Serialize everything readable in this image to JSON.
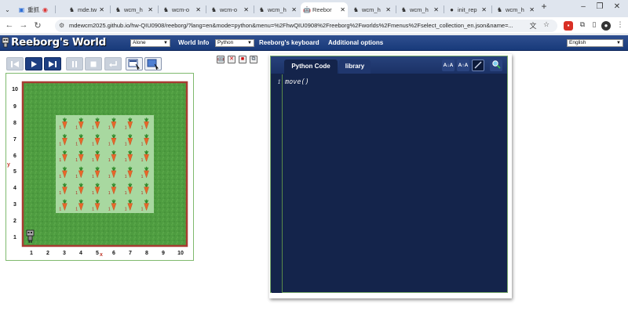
{
  "browser": {
    "tabs": [
      {
        "label": "",
        "icon": "group-icon",
        "group": "重抓"
      },
      {
        "label": "mde.tw",
        "icon": "hat-icon"
      },
      {
        "label": "wcm_h",
        "icon": "hat-icon"
      },
      {
        "label": "wcm-o",
        "icon": "hat-icon"
      },
      {
        "label": "wcm-o",
        "icon": "hat-icon"
      },
      {
        "label": "wcm_h",
        "icon": "hat-icon"
      },
      {
        "label": "Reebor",
        "icon": "robot-icon",
        "active": true
      },
      {
        "label": "wcm_h",
        "icon": "hat-icon"
      },
      {
        "label": "wcm_h",
        "icon": "hat-icon"
      },
      {
        "label": "init_rep",
        "icon": "github-icon"
      },
      {
        "label": "wcm_h",
        "icon": "hat-icon"
      }
    ],
    "url": "mdewcm2025.github.io/hw-QIU0908/reeborg/?lang=en&mode=python&menu=%2FhwQIU0908%2Freeborg%2Fworlds%2Fmenus%2Fselect_collection_en.json&name=...",
    "group_label": "重抓"
  },
  "reeborg": {
    "logo": "Reeborg's World",
    "world_select": "Alone",
    "world_info_label": "World Info",
    "mode_select": "Python",
    "keyboard_label": "Reeborg's keyboard",
    "options_label": "Additional options",
    "language_select": "English"
  },
  "world": {
    "columns": 10,
    "rows": 10,
    "x_ticks": [
      "1",
      "2",
      "3",
      "4",
      "5",
      "6",
      "7",
      "8",
      "9",
      "10"
    ],
    "y_ticks": [
      "1",
      "2",
      "3",
      "4",
      "5",
      "6",
      "7",
      "8",
      "9",
      "10"
    ],
    "x_axis_label": "x",
    "y_axis_label": "y",
    "carrot_count_label": "1",
    "carrot_columns": [
      "3",
      "4",
      "5",
      "6",
      "7",
      "8"
    ],
    "carrot_rows": [
      "3",
      "4",
      "5",
      "6",
      "7",
      "8"
    ],
    "robot_position": {
      "x": 1,
      "y": 1
    },
    "colors": {
      "grass": "#4a9a3e",
      "wall": "#a83b32",
      "carrot_tile": "#a8d8a0",
      "carrot": "#e8672a"
    }
  },
  "editor": {
    "tabs": [
      "Python Code",
      "library"
    ],
    "line_numbers": [
      "1"
    ],
    "code_lines": [
      "move()"
    ],
    "tools": [
      "A↓A",
      "A↑A"
    ]
  }
}
